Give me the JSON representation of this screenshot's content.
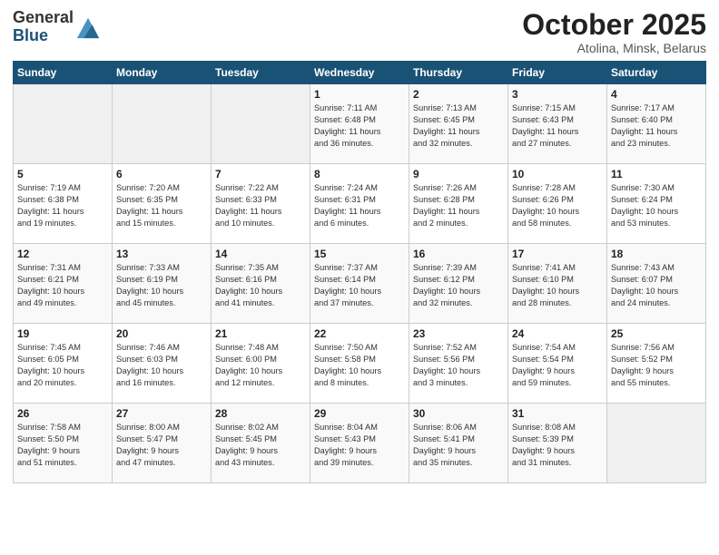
{
  "header": {
    "logo_line1": "General",
    "logo_line2": "Blue",
    "month": "October 2025",
    "location": "Atolina, Minsk, Belarus"
  },
  "weekdays": [
    "Sunday",
    "Monday",
    "Tuesday",
    "Wednesday",
    "Thursday",
    "Friday",
    "Saturday"
  ],
  "weeks": [
    [
      {
        "day": "",
        "info": ""
      },
      {
        "day": "",
        "info": ""
      },
      {
        "day": "",
        "info": ""
      },
      {
        "day": "1",
        "info": "Sunrise: 7:11 AM\nSunset: 6:48 PM\nDaylight: 11 hours\nand 36 minutes."
      },
      {
        "day": "2",
        "info": "Sunrise: 7:13 AM\nSunset: 6:45 PM\nDaylight: 11 hours\nand 32 minutes."
      },
      {
        "day": "3",
        "info": "Sunrise: 7:15 AM\nSunset: 6:43 PM\nDaylight: 11 hours\nand 27 minutes."
      },
      {
        "day": "4",
        "info": "Sunrise: 7:17 AM\nSunset: 6:40 PM\nDaylight: 11 hours\nand 23 minutes."
      }
    ],
    [
      {
        "day": "5",
        "info": "Sunrise: 7:19 AM\nSunset: 6:38 PM\nDaylight: 11 hours\nand 19 minutes."
      },
      {
        "day": "6",
        "info": "Sunrise: 7:20 AM\nSunset: 6:35 PM\nDaylight: 11 hours\nand 15 minutes."
      },
      {
        "day": "7",
        "info": "Sunrise: 7:22 AM\nSunset: 6:33 PM\nDaylight: 11 hours\nand 10 minutes."
      },
      {
        "day": "8",
        "info": "Sunrise: 7:24 AM\nSunset: 6:31 PM\nDaylight: 11 hours\nand 6 minutes."
      },
      {
        "day": "9",
        "info": "Sunrise: 7:26 AM\nSunset: 6:28 PM\nDaylight: 11 hours\nand 2 minutes."
      },
      {
        "day": "10",
        "info": "Sunrise: 7:28 AM\nSunset: 6:26 PM\nDaylight: 10 hours\nand 58 minutes."
      },
      {
        "day": "11",
        "info": "Sunrise: 7:30 AM\nSunset: 6:24 PM\nDaylight: 10 hours\nand 53 minutes."
      }
    ],
    [
      {
        "day": "12",
        "info": "Sunrise: 7:31 AM\nSunset: 6:21 PM\nDaylight: 10 hours\nand 49 minutes."
      },
      {
        "day": "13",
        "info": "Sunrise: 7:33 AM\nSunset: 6:19 PM\nDaylight: 10 hours\nand 45 minutes."
      },
      {
        "day": "14",
        "info": "Sunrise: 7:35 AM\nSunset: 6:16 PM\nDaylight: 10 hours\nand 41 minutes."
      },
      {
        "day": "15",
        "info": "Sunrise: 7:37 AM\nSunset: 6:14 PM\nDaylight: 10 hours\nand 37 minutes."
      },
      {
        "day": "16",
        "info": "Sunrise: 7:39 AM\nSunset: 6:12 PM\nDaylight: 10 hours\nand 32 minutes."
      },
      {
        "day": "17",
        "info": "Sunrise: 7:41 AM\nSunset: 6:10 PM\nDaylight: 10 hours\nand 28 minutes."
      },
      {
        "day": "18",
        "info": "Sunrise: 7:43 AM\nSunset: 6:07 PM\nDaylight: 10 hours\nand 24 minutes."
      }
    ],
    [
      {
        "day": "19",
        "info": "Sunrise: 7:45 AM\nSunset: 6:05 PM\nDaylight: 10 hours\nand 20 minutes."
      },
      {
        "day": "20",
        "info": "Sunrise: 7:46 AM\nSunset: 6:03 PM\nDaylight: 10 hours\nand 16 minutes."
      },
      {
        "day": "21",
        "info": "Sunrise: 7:48 AM\nSunset: 6:00 PM\nDaylight: 10 hours\nand 12 minutes."
      },
      {
        "day": "22",
        "info": "Sunrise: 7:50 AM\nSunset: 5:58 PM\nDaylight: 10 hours\nand 8 minutes."
      },
      {
        "day": "23",
        "info": "Sunrise: 7:52 AM\nSunset: 5:56 PM\nDaylight: 10 hours\nand 3 minutes."
      },
      {
        "day": "24",
        "info": "Sunrise: 7:54 AM\nSunset: 5:54 PM\nDaylight: 9 hours\nand 59 minutes."
      },
      {
        "day": "25",
        "info": "Sunrise: 7:56 AM\nSunset: 5:52 PM\nDaylight: 9 hours\nand 55 minutes."
      }
    ],
    [
      {
        "day": "26",
        "info": "Sunrise: 7:58 AM\nSunset: 5:50 PM\nDaylight: 9 hours\nand 51 minutes."
      },
      {
        "day": "27",
        "info": "Sunrise: 8:00 AM\nSunset: 5:47 PM\nDaylight: 9 hours\nand 47 minutes."
      },
      {
        "day": "28",
        "info": "Sunrise: 8:02 AM\nSunset: 5:45 PM\nDaylight: 9 hours\nand 43 minutes."
      },
      {
        "day": "29",
        "info": "Sunrise: 8:04 AM\nSunset: 5:43 PM\nDaylight: 9 hours\nand 39 minutes."
      },
      {
        "day": "30",
        "info": "Sunrise: 8:06 AM\nSunset: 5:41 PM\nDaylight: 9 hours\nand 35 minutes."
      },
      {
        "day": "31",
        "info": "Sunrise: 8:08 AM\nSunset: 5:39 PM\nDaylight: 9 hours\nand 31 minutes."
      },
      {
        "day": "",
        "info": ""
      }
    ]
  ]
}
